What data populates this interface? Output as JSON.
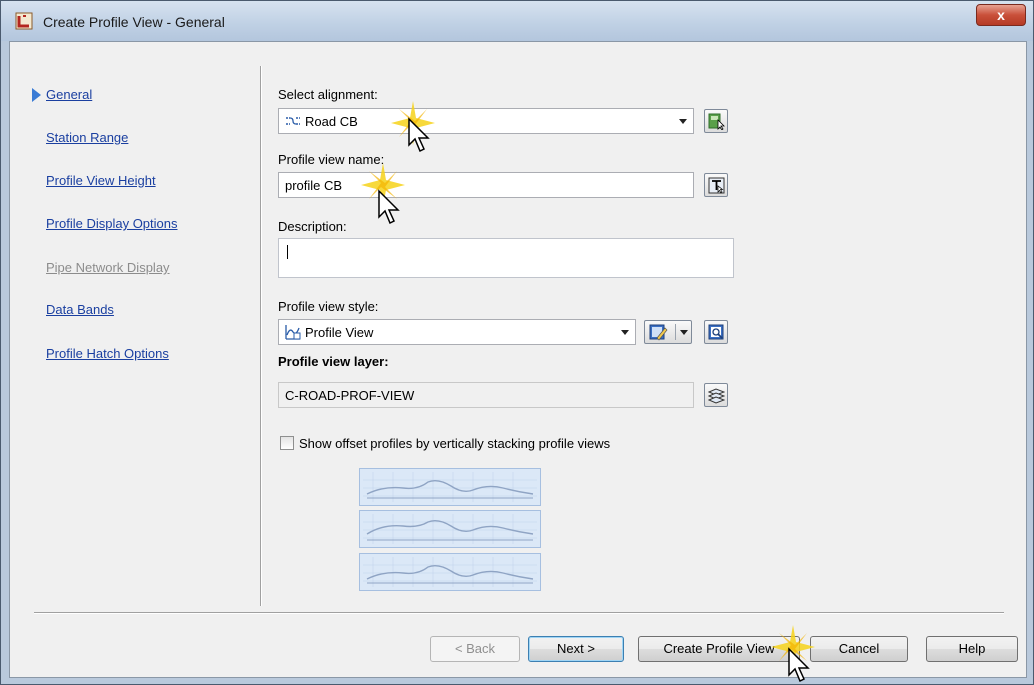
{
  "window": {
    "title": "Create Profile View - General",
    "close_label": "x"
  },
  "nav": {
    "items": [
      {
        "label": "General",
        "active": true
      },
      {
        "label": "Station Range"
      },
      {
        "label": "Profile View Height"
      },
      {
        "label": "Profile Display Options"
      },
      {
        "label": "Pipe Network Display",
        "disabled": true
      },
      {
        "label": "Data Bands"
      },
      {
        "label": "Profile Hatch Options"
      }
    ]
  },
  "form": {
    "alignment_label": "Select alignment:",
    "alignment_value": "Road CB",
    "name_label": "Profile view name:",
    "name_value": "profile CB",
    "description_label": "Description:",
    "description_value": "",
    "style_label": "Profile view style:",
    "style_value": "Profile View",
    "layer_label": "Profile view layer:",
    "layer_value": "C-ROAD-PROF-VIEW",
    "stack_label": "Show offset profiles by vertically stacking profile views",
    "stack_checked": false
  },
  "buttons": {
    "back": "< Back",
    "next": "Next >",
    "create": "Create Profile View",
    "cancel": "Cancel",
    "help": "Help"
  },
  "colors": {
    "link": "#1a3fa0",
    "accent": "#3a7bd5",
    "preview_bg": "#dbe8f7"
  }
}
